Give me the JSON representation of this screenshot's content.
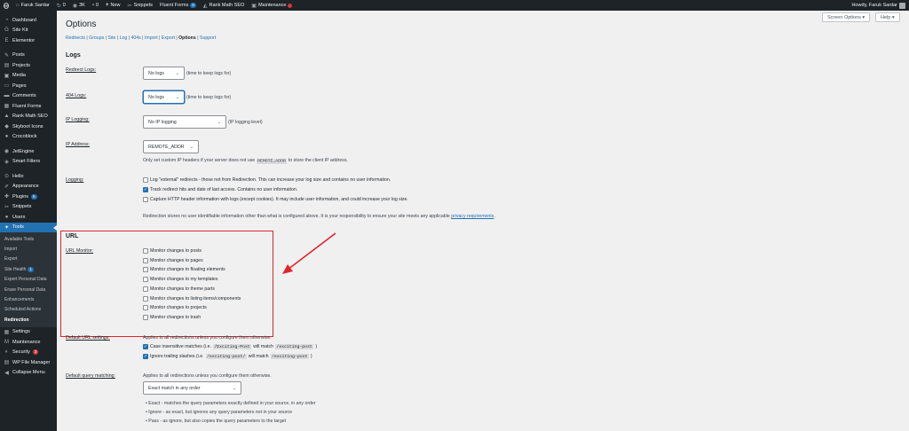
{
  "adminbar": {
    "site_name": "Faruk Sardar",
    "updates_count": "0",
    "third_item": "3K",
    "comments_count": "0",
    "new_label": "New",
    "snippets_label": "Snippets",
    "fluent_forms_label": "Fluent Forms",
    "fluent_forms_badge": "6",
    "rank_math_label": "Rank Math SEO",
    "maintenance_label": "Maintenance",
    "howdy": "Howdy, Faruk Sardar"
  },
  "sidebar": {
    "items": [
      {
        "label": "Dashboard",
        "icon": "◔"
      },
      {
        "label": "Site Kit",
        "icon": "G"
      },
      {
        "label": "Elementor",
        "icon": "E"
      },
      {
        "label": "Posts",
        "icon": "✎"
      },
      {
        "label": "Projects",
        "icon": "▤"
      },
      {
        "label": "Media",
        "icon": "▣"
      },
      {
        "label": "Pages",
        "icon": "▭"
      },
      {
        "label": "Comments",
        "icon": "▬"
      },
      {
        "label": "Fluent Forms",
        "icon": "▦"
      },
      {
        "label": "Rank Math SEO",
        "icon": "▲"
      },
      {
        "label": "Skyboot Icons",
        "icon": "◆"
      },
      {
        "label": "Crocoblock",
        "icon": "●"
      },
      {
        "label": "JetEngine",
        "icon": "◉"
      },
      {
        "label": "Smart Filters",
        "icon": "◈"
      },
      {
        "label": "Hello",
        "icon": "⊙"
      },
      {
        "label": "Appearance",
        "icon": "✐"
      },
      {
        "label": "Plugins",
        "icon": "✚",
        "badge": "5"
      },
      {
        "label": "Snippets",
        "icon": "✂"
      },
      {
        "label": "Users",
        "icon": "●"
      },
      {
        "label": "Tools",
        "icon": "✦"
      }
    ],
    "submenu": [
      {
        "label": "Available Tools"
      },
      {
        "label": "Import"
      },
      {
        "label": "Export"
      },
      {
        "label": "Site Health",
        "badge": "1"
      },
      {
        "label": "Export Personal Data"
      },
      {
        "label": "Erase Personal Data"
      },
      {
        "label": "Enhancements"
      },
      {
        "label": "Scheduled Actions"
      },
      {
        "label": "Redirection"
      }
    ],
    "after": [
      {
        "label": "Settings",
        "icon": "▦"
      },
      {
        "label": "Maintenance",
        "icon": "M"
      },
      {
        "label": "Security",
        "icon": "◐",
        "badge": "3"
      },
      {
        "label": "WP File Manager",
        "icon": "▤"
      },
      {
        "label": "Collapse Menu",
        "icon": "◀"
      }
    ]
  },
  "header": {
    "screen_options": "Screen Options ▾",
    "help": "Help ▾",
    "title": "Options"
  },
  "subnav": {
    "items": [
      "Redirects",
      "Groups",
      "Site",
      "Log",
      "404s",
      "Import",
      "Export",
      "Options",
      "Support"
    ]
  },
  "logs": {
    "heading": "Logs",
    "redirect_logs_label": "Redirect Logs:",
    "redirect_logs_value": "No logs",
    "redirect_logs_hint": "(time to keep logs for)",
    "logs404_label": "404 Logs:",
    "logs404_value": "No logs",
    "logs404_hint": "(time to keep logs for)",
    "ip_logging_label": "IP Logging:",
    "ip_logging_value": "No IP logging",
    "ip_logging_hint": "(IP logging level)",
    "ip_address_label": "IP Address:",
    "ip_address_value": "REMOTE_ADDR",
    "ip_note_pre": "Only set custom IP headers if your server does not use",
    "ip_note_code": "REMOTE_ADDR",
    "ip_note_post": "to store the client IP address.",
    "logging_label": "Logging:",
    "logging_options": [
      {
        "label": "Log \"external\" redirects - those not from Redirection. This can increase your log size and contains no user information.",
        "checked": false
      },
      {
        "label": "Track redirect hits and date of last access. Contains no user information.",
        "checked": true
      },
      {
        "label": "Capture HTTP header information with logs (except cookies). It may include user information, and could increase your log size.",
        "checked": false
      }
    ],
    "privacy_note": "Redirection stores no user identifiable information other than what is configured above. It is your responsibility to ensure your site meets any applicable",
    "privacy_link": "privacy requirements"
  },
  "url": {
    "heading": "URL",
    "monitor_label": "URL Monitor:",
    "monitor_options": [
      "Monitor changes to posts",
      "Monitor changes to pages",
      "Monitor changes to floating elements",
      "Monitor changes to my templates",
      "Monitor changes to theme parts",
      "Monitor changes to listing items/components",
      "Monitor changes to projects",
      "Monitor changes to trash"
    ],
    "default_settings_label": "Default URL settings:",
    "default_settings_note": "Applies to all redirections unless you configure them otherwise.",
    "case_pre": "Case insensitive matches (i.e.",
    "case_code1": "/Exciting-Post",
    "case_mid": "will match",
    "case_code2": "/exciting-post",
    "case_post": ")",
    "slash_pre": "Ignore trailing slashes (i.e.",
    "slash_code1": "/exciting-post/",
    "slash_mid": "will match",
    "slash_code2": "/exciting-post",
    "slash_post": ")",
    "query_label": "Default query matching:",
    "query_note": "Applies to all redirections unless you configure them otherwise.",
    "query_value": "Exact match in any order",
    "query_bullets": [
      "Exact - matches the query parameters exactly defined in your source, in any order",
      "Ignore - as exact, but ignores any query parameters not in your source",
      "Pass - as ignore, but also copies the query parameters to the target"
    ]
  },
  "colors": {
    "accent": "#2271b1",
    "sidebar_bg": "#1d2327",
    "annotation": "#e0242b"
  }
}
